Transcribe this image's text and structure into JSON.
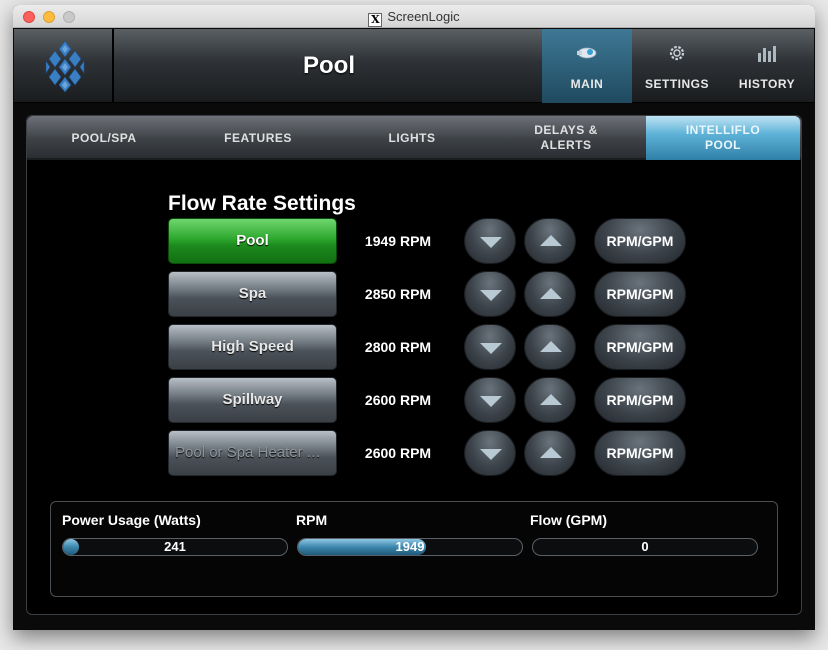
{
  "window": {
    "title": "ScreenLogic",
    "x_glyph": "X"
  },
  "header": {
    "title": "Pool",
    "tabs": [
      {
        "label": "MAIN",
        "icon": "pump-icon",
        "active": true
      },
      {
        "label": "SETTINGS",
        "icon": "gear-icon",
        "active": false
      },
      {
        "label": "HISTORY",
        "icon": "bar-chart-icon",
        "active": false
      }
    ]
  },
  "subtabs": [
    {
      "label": "POOL/SPA"
    },
    {
      "label": "FEATURES"
    },
    {
      "label": "LIGHTS"
    },
    {
      "label": "DELAYS &\nALERTS"
    },
    {
      "label": "INTELLIFLO\nPOOL",
      "active": true
    }
  ],
  "flow": {
    "title": "Flow Rate Settings",
    "rows": [
      {
        "name": "Pool",
        "rpm": "1949 RPM",
        "unit_label": "RPM/GPM",
        "state": "active"
      },
      {
        "name": "Spa",
        "rpm": "2850 RPM",
        "unit_label": "RPM/GPM",
        "state": "normal"
      },
      {
        "name": "High Speed",
        "rpm": "2800 RPM",
        "unit_label": "RPM/GPM",
        "state": "normal"
      },
      {
        "name": "Spillway",
        "rpm": "2600 RPM",
        "unit_label": "RPM/GPM",
        "state": "normal"
      },
      {
        "name": "Pool or Spa Heater A…",
        "rpm": "2600 RPM",
        "unit_label": "RPM/GPM",
        "state": "dim"
      }
    ]
  },
  "stats": {
    "power": {
      "label": "Power Usage (Watts)",
      "value": "241",
      "fill_fraction": 0.05
    },
    "rpm": {
      "label": "RPM",
      "value": "1949",
      "fill_fraction": 0.57
    },
    "flow": {
      "label": "Flow (GPM)",
      "value": "0",
      "fill_fraction": 0.0
    }
  },
  "colors": {
    "active_green": "#2ea82e",
    "accent_blue": "#3d87ad"
  }
}
